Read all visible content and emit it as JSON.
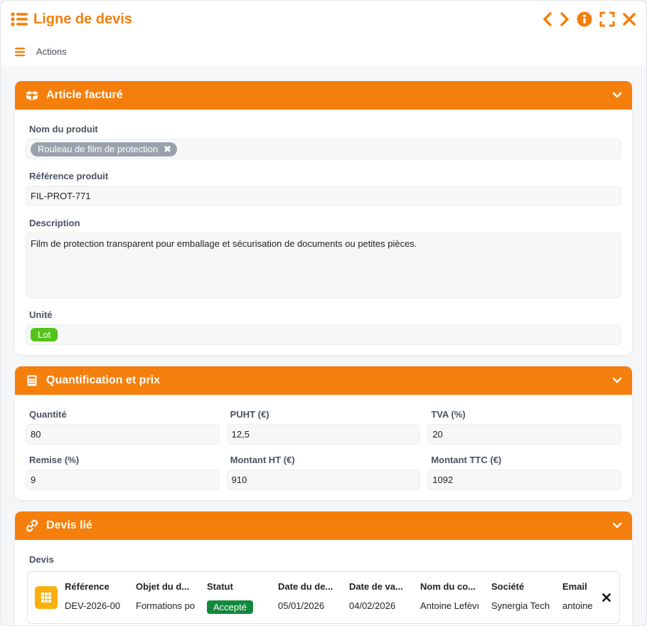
{
  "window": {
    "title": "Ligne de devis",
    "actions_label": "Actions"
  },
  "colors": {
    "accent": "#f57f0c",
    "status_green": "#13883d",
    "unit_green": "#54c21b"
  },
  "sections": {
    "article": {
      "title": "Article facturé",
      "product_label": "Nom du produit",
      "product_value": "Rouleau de film de protection",
      "reference_label": "Référence produit",
      "reference_value": "FIL-PROT-771",
      "description_label": "Description",
      "description_value": "Film de protection transparent pour emballage et sécurisation de documents ou petites pièces.",
      "unit_label": "Unité",
      "unit_value": "Lot"
    },
    "pricing": {
      "title": "Quantification et prix",
      "fields": [
        {
          "label": "Quantité",
          "value": "80"
        },
        {
          "label": "PUHT (€)",
          "value": "12,5"
        },
        {
          "label": "TVA (%)",
          "value": "20"
        },
        {
          "label": "Remise (%)",
          "value": "9"
        },
        {
          "label": "Montant HT (€)",
          "value": "910"
        },
        {
          "label": "Montant TTC (€)",
          "value": "1092"
        }
      ]
    },
    "quote": {
      "title": "Devis lié",
      "field_label": "Devis",
      "columns": [
        {
          "header": "Référence",
          "value": "DEV-2026-00"
        },
        {
          "header": "Objet du d...",
          "value": "Formations po"
        },
        {
          "header": "Statut",
          "value": "Accepté"
        },
        {
          "header": "Date du de...",
          "value": "05/01/2026"
        },
        {
          "header": "Date de va...",
          "value": "04/02/2026"
        },
        {
          "header": "Nom du co...",
          "value": "Antoine Lefèvı"
        },
        {
          "header": "Société",
          "value": "Synergia Tech"
        },
        {
          "header": "Email",
          "value": "antoine"
        }
      ]
    }
  }
}
